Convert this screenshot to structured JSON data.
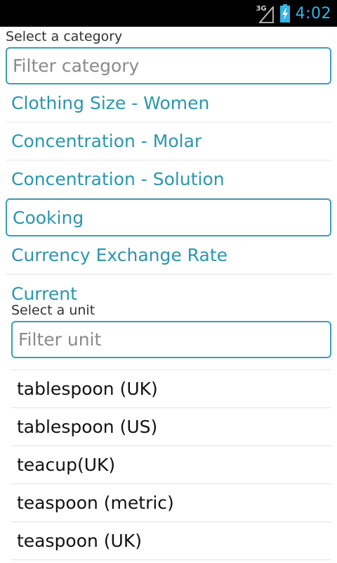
{
  "status_bar": {
    "network_label": "3G",
    "time": "4:02",
    "accent_color": "#33b5e5"
  },
  "category": {
    "label": "Select a category",
    "filter_placeholder": "Filter category",
    "items": [
      {
        "label": "Clothing Size - Women",
        "selected": false
      },
      {
        "label": "Concentration - Molar",
        "selected": false
      },
      {
        "label": "Concentration - Solution",
        "selected": false
      },
      {
        "label": "Cooking",
        "selected": true
      },
      {
        "label": "Currency Exchange Rate",
        "selected": false
      },
      {
        "label": "Current",
        "selected": false
      }
    ]
  },
  "unit": {
    "label": "Select a unit",
    "filter_placeholder": "Filter unit",
    "items": [
      {
        "label": "tablespoon (UK)"
      },
      {
        "label": "tablespoon (US)"
      },
      {
        "label": "teacup(UK)"
      },
      {
        "label": "teaspoon (metric)"
      },
      {
        "label": "teaspoon (UK)"
      }
    ]
  },
  "colors": {
    "accent": "#2a96ad",
    "border": "#3aa0b0"
  }
}
